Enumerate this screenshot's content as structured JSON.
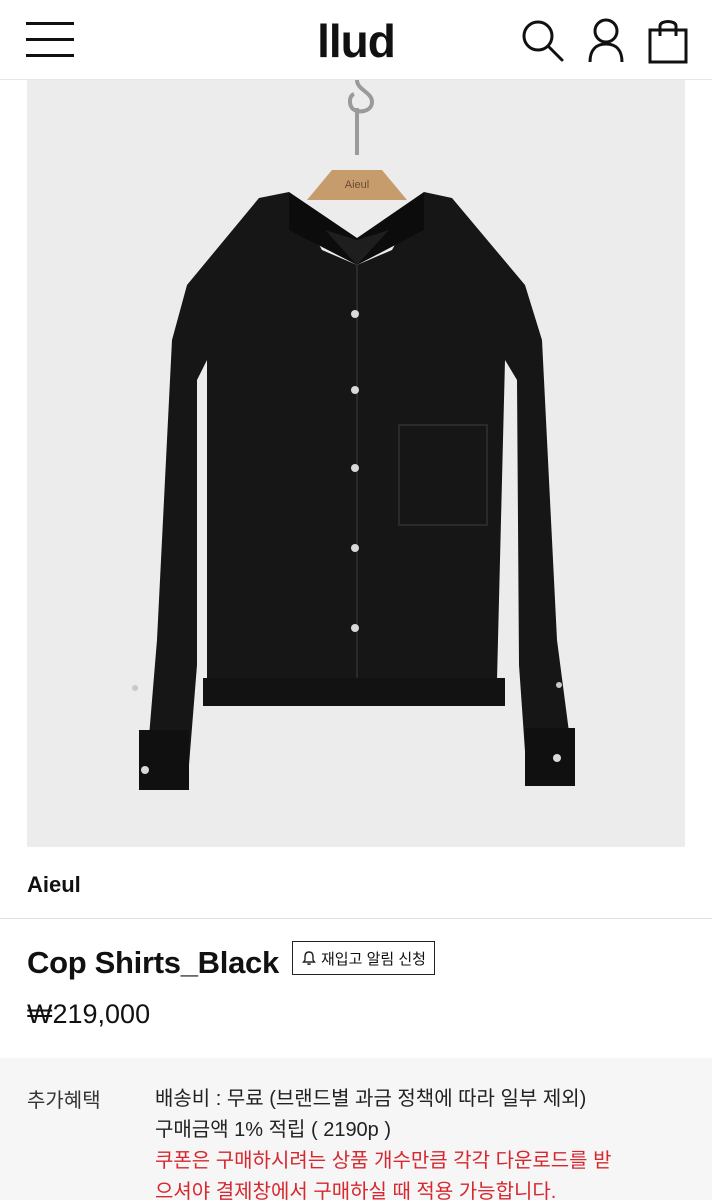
{
  "header": {
    "logo": "llud",
    "icons": [
      "menu-icon",
      "search-icon",
      "user-icon",
      "shopping-bag-icon"
    ]
  },
  "product": {
    "image_alt": "black shirt on wooden hanger",
    "hanger_text": "Aieul",
    "brand": "Aieul",
    "title": "Cop Shirts_Black",
    "restock_label": "재입고 알림 신청",
    "price": "₩219,000"
  },
  "benefits": {
    "label": "추가혜택",
    "shipping": "배송비 : 무료 (브랜드별 과금 정책에 따라 일부 제외)",
    "points": "구매금액 1% 적립 ( 2190p )",
    "coupon_line1": "쿠폰은 구매하시려는 상품 개수만큼 각각 다운로드를 받",
    "coupon_line2": "으셔야 결제창에서 구매하실 때 적용 가능합니다."
  },
  "colors": {
    "accent_red": "#d7282f",
    "text": "#111111",
    "benefits_bg": "#f6f6f6",
    "image_bg": "#ededed"
  }
}
